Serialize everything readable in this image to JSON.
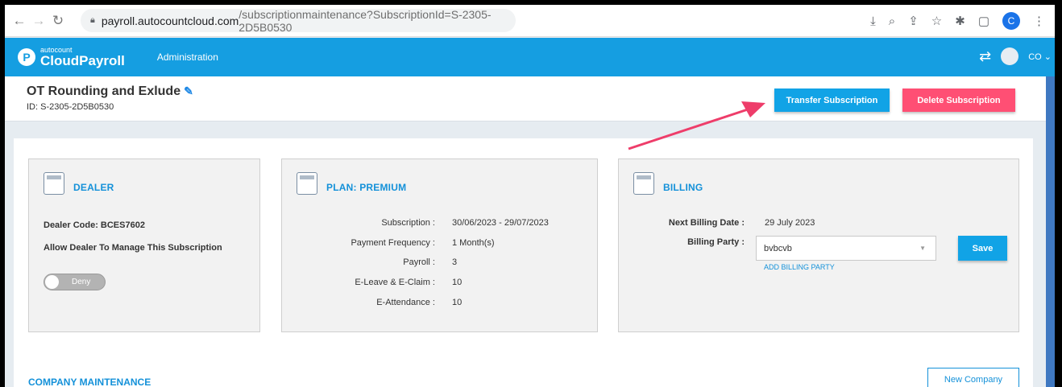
{
  "browser": {
    "url_host": "payroll.autocountcloud.com",
    "url_path": "/subscriptionmaintenance?SubscriptionId=S-2305-2D5B0530",
    "profile_initial": "C"
  },
  "app": {
    "logo_small": "autocount",
    "logo_big": "CloudPayroll",
    "nav_admin": "Administration",
    "user_code": "CO"
  },
  "page": {
    "title": "OT Rounding and Exlude",
    "id_text": "ID: S-2305-2D5B0530",
    "transfer_label": "Transfer Subscription",
    "delete_label": "Delete Subscription"
  },
  "dealer": {
    "title": "DEALER",
    "code": "Dealer Code: BCES7602",
    "allow_text": "Allow Dealer To Manage This Subscription",
    "toggle_label": "Deny"
  },
  "plan": {
    "title": "PLAN: PREMIUM",
    "rows": [
      {
        "label": "Subscription :",
        "value": "30/06/2023 - 29/07/2023"
      },
      {
        "label": "Payment Frequency :",
        "value": "1 Month(s)"
      },
      {
        "label": "Payroll :",
        "value": "3"
      },
      {
        "label": "E-Leave & E-Claim :",
        "value": "10"
      },
      {
        "label": "E-Attendance :",
        "value": "10"
      }
    ]
  },
  "billing": {
    "title": "BILLING",
    "next_label": "Next Billing Date :",
    "next_value": "29 July 2023",
    "party_label": "Billing Party :",
    "party_value": "bvbcvb",
    "add_party": "ADD BILLING PARTY",
    "save_label": "Save"
  },
  "company": {
    "title": "COMPANY MAINTENANCE",
    "new_label": "New Company"
  },
  "colors": {
    "primary": "#159ee1",
    "danger": "#ff4f74",
    "accent_arrow": "#ee3d6a"
  }
}
